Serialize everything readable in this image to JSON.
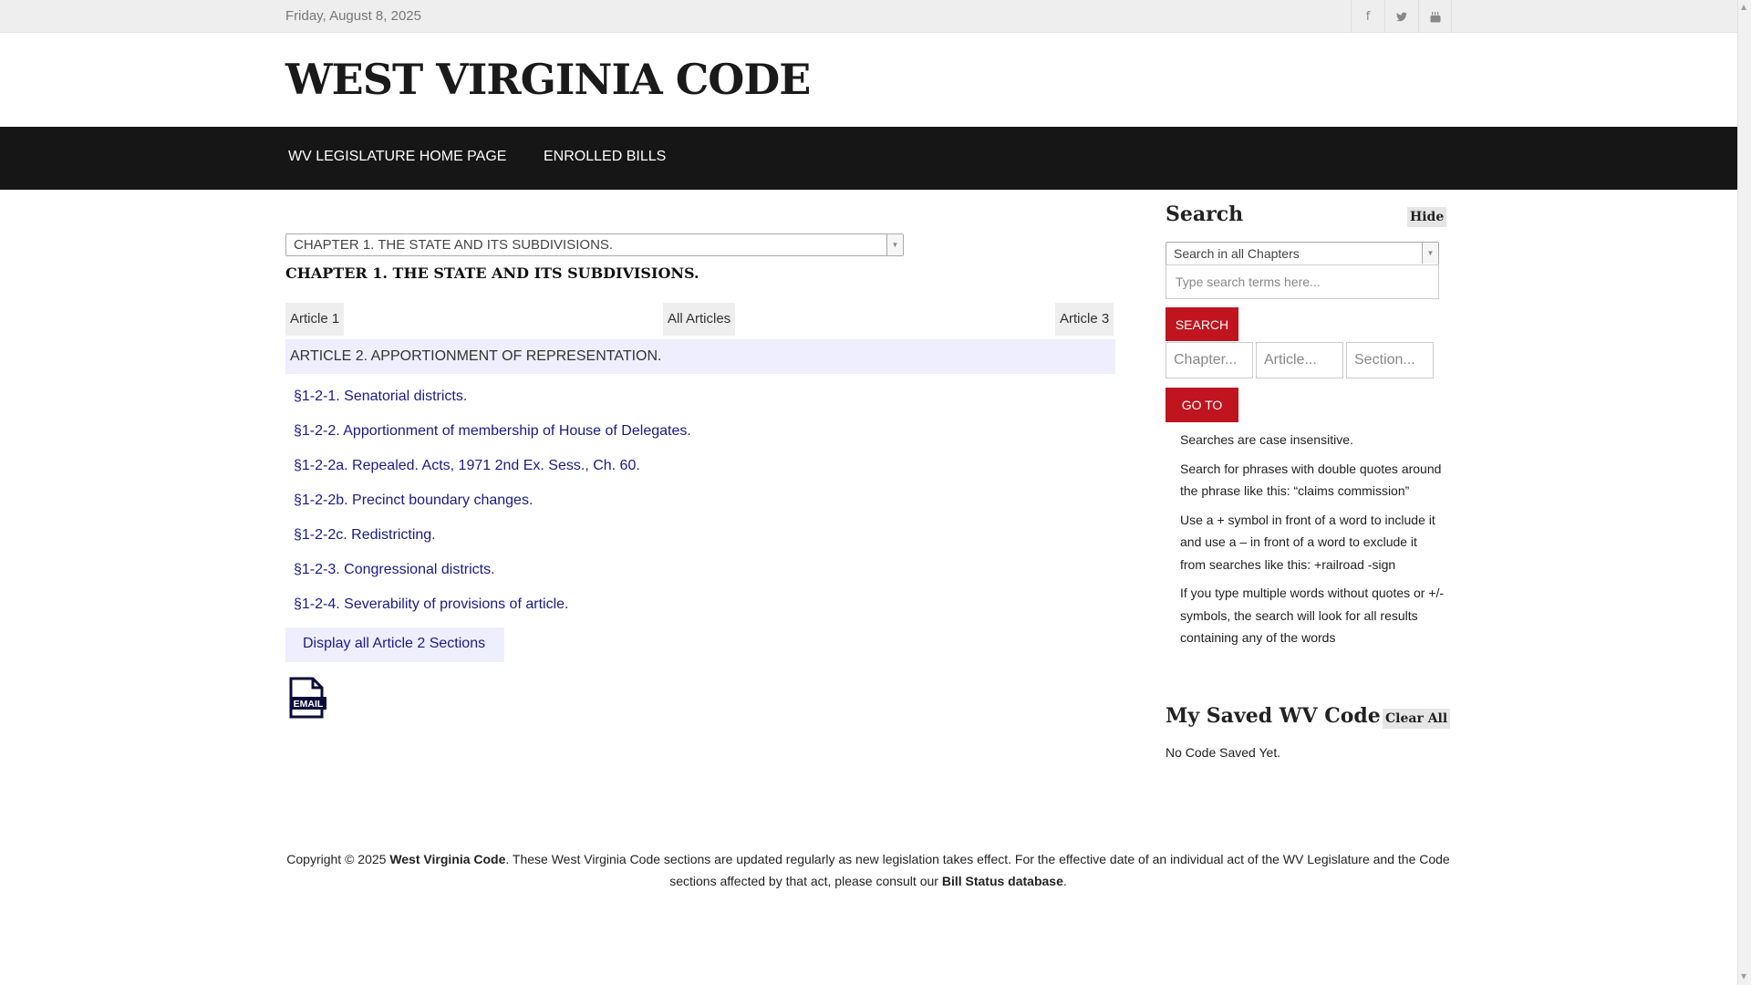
{
  "topbar": {
    "date": "Friday, August 8, 2025",
    "social": [
      {
        "icon": "facebook-icon",
        "glyph": "f"
      },
      {
        "icon": "twitter-icon",
        "glyph": "🐦"
      },
      {
        "icon": "youtube-icon",
        "glyph": "▶"
      }
    ]
  },
  "header": {
    "title": "WEST VIRGINIA CODE"
  },
  "nav": {
    "home": "WV LEGISLATURE HOME PAGE",
    "enrolled": "ENROLLED BILLS"
  },
  "main": {
    "chapter_select": "CHAPTER 1. THE STATE AND ITS SUBDIVISIONS.",
    "chapter_heading": "CHAPTER 1. THE STATE AND ITS SUBDIVISIONS.",
    "prev_article": "Article 1",
    "all_articles": "All Articles",
    "next_article": "Article 3",
    "article_title": "ARTICLE 2. APPORTIONMENT OF REPRESENTATION.",
    "sections": [
      "§1-2-1. Senatorial districts.",
      "§1-2-2. Apportionment of membership of House of Delegates.",
      "§1-2-2a. Repealed. Acts, 1971 2nd Ex. Sess., Ch. 60.",
      "§1-2-2b. Precinct boundary changes.",
      "§1-2-2c. Redistricting.",
      "§1-2-3. Congressional districts.",
      "§1-2-4. Severability of provisions of article."
    ],
    "display_all": "Display all Article 2 Sections",
    "email_label": "EMAIL"
  },
  "sidebar": {
    "search_heading": "Search",
    "hide_label": "Hide",
    "scope_select": "Search in all Chapters",
    "search_placeholder": "Type search terms here...",
    "search_button": "SEARCH",
    "chapter_placeholder": "Chapter...",
    "article_placeholder": "Article...",
    "section_placeholder": "Section...",
    "goto_button": "GO TO",
    "tips": [
      "Searches are case insensitive.",
      "Search for phrases with double quotes around the phrase like this: “claims commission”",
      "Use a + symbol in front of a word to include it and use a – in front of a word to exclude it from searches like this: +railroad -sign",
      "If you type multiple words without quotes or +/- symbols, the search will look for all results containing any of the words"
    ],
    "saved_heading": "My Saved WV Code",
    "clear_all": "Clear All",
    "no_saved": "No Code Saved Yet."
  },
  "footer": {
    "part1": "Copyright © 2025 ",
    "brand": "West Virginia Code",
    "part2": ". These West Virginia Code sections are updated regularly as new legislation takes effect. For the effective date of an individual act of the WV Legislature and the Code sections affected by that act, please consult our ",
    "link": "Bill Status database",
    "part3": "."
  },
  "colors": {
    "nav_bg": "#161616",
    "accent_red": "#c0141e",
    "link_blue": "#1a1a8c",
    "highlight_bg": "#eeeeff"
  }
}
